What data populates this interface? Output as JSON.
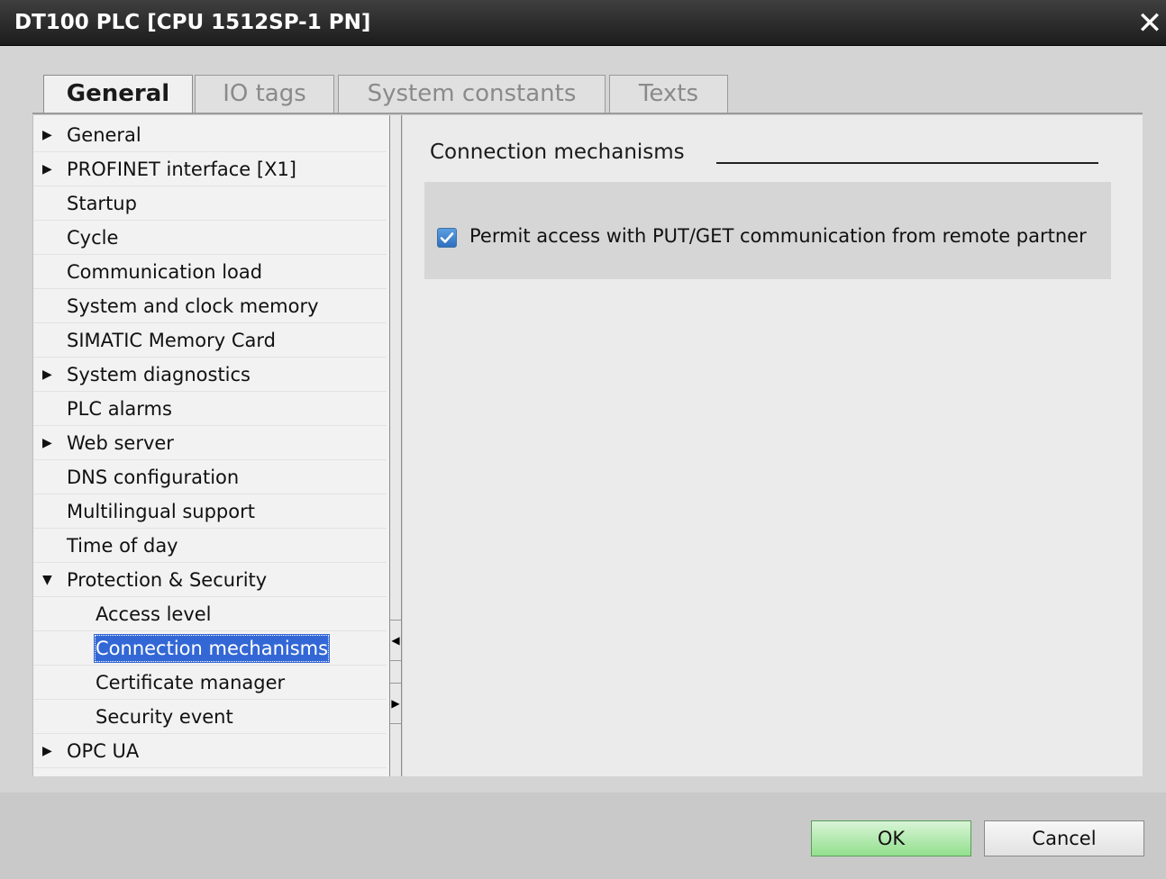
{
  "window": {
    "title": "DT100 PLC [CPU 1512SP-1 PN]",
    "close_glyph": "✕"
  },
  "tabs": [
    {
      "label": "General",
      "active": true
    },
    {
      "label": "IO tags",
      "active": false
    },
    {
      "label": "System constants",
      "active": false
    },
    {
      "label": "Texts",
      "active": false
    }
  ],
  "nav": {
    "items": [
      {
        "label": "General",
        "arrow": "▶",
        "level": 0
      },
      {
        "label": "PROFINET interface [X1]",
        "arrow": "▶",
        "level": 0
      },
      {
        "label": "Startup",
        "arrow": "",
        "level": 0
      },
      {
        "label": "Cycle",
        "arrow": "",
        "level": 0
      },
      {
        "label": "Communication load",
        "arrow": "",
        "level": 0
      },
      {
        "label": "System and clock memory",
        "arrow": "",
        "level": 0
      },
      {
        "label": "SIMATIC Memory Card",
        "arrow": "",
        "level": 0
      },
      {
        "label": "System diagnostics",
        "arrow": "▶",
        "level": 0
      },
      {
        "label": "PLC alarms",
        "arrow": "",
        "level": 0
      },
      {
        "label": "Web server",
        "arrow": "▶",
        "level": 0
      },
      {
        "label": "DNS configuration",
        "arrow": "",
        "level": 0
      },
      {
        "label": "Multilingual support",
        "arrow": "",
        "level": 0
      },
      {
        "label": "Time of day",
        "arrow": "",
        "level": 0
      },
      {
        "label": "Protection & Security",
        "arrow": "▼",
        "level": 0
      },
      {
        "label": "Access level",
        "arrow": "",
        "level": 1
      },
      {
        "label": "Connection mechanisms",
        "arrow": "",
        "level": 1,
        "selected": true
      },
      {
        "label": "Certificate manager",
        "arrow": "",
        "level": 1
      },
      {
        "label": "Security event",
        "arrow": "",
        "level": 1
      },
      {
        "label": "OPC UA",
        "arrow": "▶",
        "level": 0
      }
    ]
  },
  "splitter": {
    "collapse_glyph": "◀",
    "expand_glyph": "▶"
  },
  "content": {
    "section_title": "Connection mechanisms",
    "putget_label": "Permit access with PUT/GET communication from remote partner",
    "putget_checked": true
  },
  "footer": {
    "ok_label": "OK",
    "cancel_label": "Cancel"
  },
  "colors": {
    "selection": "#3367d6",
    "ok_button": "#92e08e",
    "checkbox": "#2f6fc0"
  }
}
